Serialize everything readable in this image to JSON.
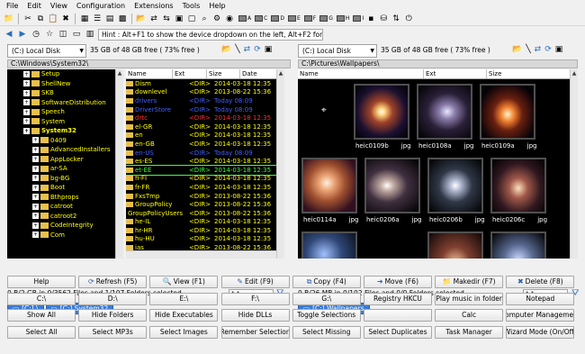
{
  "menu": [
    "File",
    "Edit",
    "View",
    "Configuration",
    "Extensions",
    "Tools",
    "Help"
  ],
  "hint": "Hint : Alt+F1 to show the device dropdown on the left, Alt+F2 for the right",
  "toolbar_drives": [
    "A",
    "C",
    "D",
    "E",
    "F",
    "G",
    "H",
    "I"
  ],
  "left": {
    "drive": "(C:) Local Disk",
    "free": "35 GB of 48 GB free ( 73% free )",
    "path": "C:\\Windows\\System32\\",
    "tree": [
      {
        "name": "Setup",
        "indent": 0,
        "cls": "yel"
      },
      {
        "name": "ShellNew",
        "indent": 0,
        "cls": "yel"
      },
      {
        "name": "SKB",
        "indent": 0,
        "cls": "yel"
      },
      {
        "name": "SoftwareDistribution",
        "indent": 0,
        "cls": "yel"
      },
      {
        "name": "Speech",
        "indent": 0,
        "cls": "yel"
      },
      {
        "name": "System",
        "indent": 0,
        "cls": "yel"
      },
      {
        "name": "System32",
        "indent": 0,
        "cls": "sel"
      },
      {
        "name": "0409",
        "indent": 1,
        "cls": "yel"
      },
      {
        "name": "AdvancedInstallers",
        "indent": 1,
        "cls": "yel"
      },
      {
        "name": "AppLocker",
        "indent": 1,
        "cls": "yel"
      },
      {
        "name": "ar-SA",
        "indent": 1,
        "cls": "yel"
      },
      {
        "name": "bg-BG",
        "indent": 1,
        "cls": "yel"
      },
      {
        "name": "Boot",
        "indent": 1,
        "cls": "yel"
      },
      {
        "name": "Bthprops",
        "indent": 1,
        "cls": "yel"
      },
      {
        "name": "catroot",
        "indent": 1,
        "cls": "yel"
      },
      {
        "name": "catroot2",
        "indent": 1,
        "cls": "yel"
      },
      {
        "name": "CodeIntegrity",
        "indent": 1,
        "cls": "yel"
      },
      {
        "name": "Com",
        "indent": 1,
        "cls": "yel"
      }
    ],
    "columns": [
      "Name",
      "Ext",
      "Size",
      "Date"
    ],
    "files": [
      {
        "name": "Dism",
        "size": "<DIR>",
        "date": "2014-03-18 12:35",
        "c": "c-y"
      },
      {
        "name": "downlevel",
        "size": "<DIR>",
        "date": "2013-08-22 15:36",
        "c": "c-y"
      },
      {
        "name": "drivers",
        "size": "<DIR>",
        "date": "Today 08:09",
        "c": "c-b"
      },
      {
        "name": "DriverStore",
        "size": "<DIR>",
        "date": "Today 08:09",
        "c": "c-b"
      },
      {
        "name": "drtc",
        "size": "<DIR>",
        "date": "2014-03-18 12:35",
        "c": "c-r"
      },
      {
        "name": "el-GR",
        "size": "<DIR>",
        "date": "2014-03-18 12:35",
        "c": "c-y"
      },
      {
        "name": "en",
        "size": "<DIR>",
        "date": "2014-03-18 12:35",
        "c": "c-y"
      },
      {
        "name": "en-GB",
        "size": "<DIR>",
        "date": "2014-03-18 12:35",
        "c": "c-y"
      },
      {
        "name": "en-US",
        "size": "<DIR>",
        "date": "Today 08:09",
        "c": "c-b"
      },
      {
        "name": "es-ES",
        "size": "<DIR>",
        "date": "2014-03-18 12:35",
        "c": "c-y"
      },
      {
        "name": "et-EE",
        "size": "<DIR>",
        "date": "2014-03-18 12:35",
        "c": "c-g"
      },
      {
        "name": "fi-FI",
        "size": "<DIR>",
        "date": "2014-03-18 12:35",
        "c": "c-y"
      },
      {
        "name": "fr-FR",
        "size": "<DIR>",
        "date": "2014-03-18 12:35",
        "c": "c-y"
      },
      {
        "name": "FxsTmp",
        "size": "<DIR>",
        "date": "2013-08-22 15:36",
        "c": "c-y"
      },
      {
        "name": "GroupPolicy",
        "size": "<DIR>",
        "date": "2013-08-22 15:36",
        "c": "c-y"
      },
      {
        "name": "GroupPolicyUsers",
        "size": "<DIR>",
        "date": "2013-08-22 15:36",
        "c": "c-y"
      },
      {
        "name": "he-IL",
        "size": "<DIR>",
        "date": "2014-03-18 12:35",
        "c": "c-y"
      },
      {
        "name": "hr-HR",
        "size": "<DIR>",
        "date": "2014-03-18 12:35",
        "c": "c-y"
      },
      {
        "name": "hu-HU",
        "size": "<DIR>",
        "date": "2014-03-18 12:35",
        "c": "c-y"
      },
      {
        "name": "ias",
        "size": "<DIR>",
        "date": "2013-08-22 15:36",
        "c": "c-y"
      }
    ],
    "selection": "0 B/2 GB in 0/3562 Files and 1/107 Folders selected",
    "filter": "*.*",
    "tabs": [
      "[C:] \\",
      "[C:] System32"
    ]
  },
  "right": {
    "drive": "(C:) Local Disk",
    "free": "35 GB of 48 GB free ( 73% free )",
    "path": "C:\\Pictures\\Wallpapers\\",
    "columns": [
      "Name",
      "Ext",
      "Size"
    ],
    "thumbs": [
      {
        "name": "heic0109b",
        "ext": "jpg"
      },
      {
        "name": "heic0108a",
        "ext": "jpg"
      },
      {
        "name": "heic0109a",
        "ext": "jpg"
      },
      {
        "name": "heic0114a",
        "ext": "jpg"
      },
      {
        "name": "heic0206a",
        "ext": "jpg"
      },
      {
        "name": "heic0206b",
        "ext": "jpg"
      },
      {
        "name": "heic0206c",
        "ext": "jpg"
      },
      {
        "name": "",
        "ext": ""
      },
      {
        "name": "",
        "ext": ""
      },
      {
        "name": "",
        "ext": ""
      }
    ],
    "selection": "0 B/26 MB in 0/102 Files and 0/0 Folders selected",
    "filter": "*.*",
    "tabs": [
      "[C:] Wallpapers"
    ]
  },
  "buttons": [
    "Help",
    "Refresh (F5)",
    "View (F1)",
    "Edit (F9)",
    "Copy (F4)",
    "Move (F6)",
    "Makedir (F7)",
    "Delete (F8)",
    "C:\\",
    "D:\\",
    "E:\\",
    "F:\\",
    "G:\\",
    "Registry HKCU",
    "Play music in folder",
    "Notepad",
    "Show All",
    "Hide Folders",
    "Hide Executables",
    "Hide DLLs",
    "Toggle Selections",
    "",
    "Calc",
    "Computer Management",
    "Select All",
    "Select MP3s",
    "Select Images",
    "Remember Selection",
    "Select Missing",
    "Select Duplicates",
    "Task Manager",
    "Wizard Mode (On/Off)"
  ],
  "button_icons": {
    "1": "⟳",
    "2": "🔍",
    "3": "✎",
    "4": "⧉",
    "5": "➜",
    "6": "📁",
    "7": "✖"
  }
}
